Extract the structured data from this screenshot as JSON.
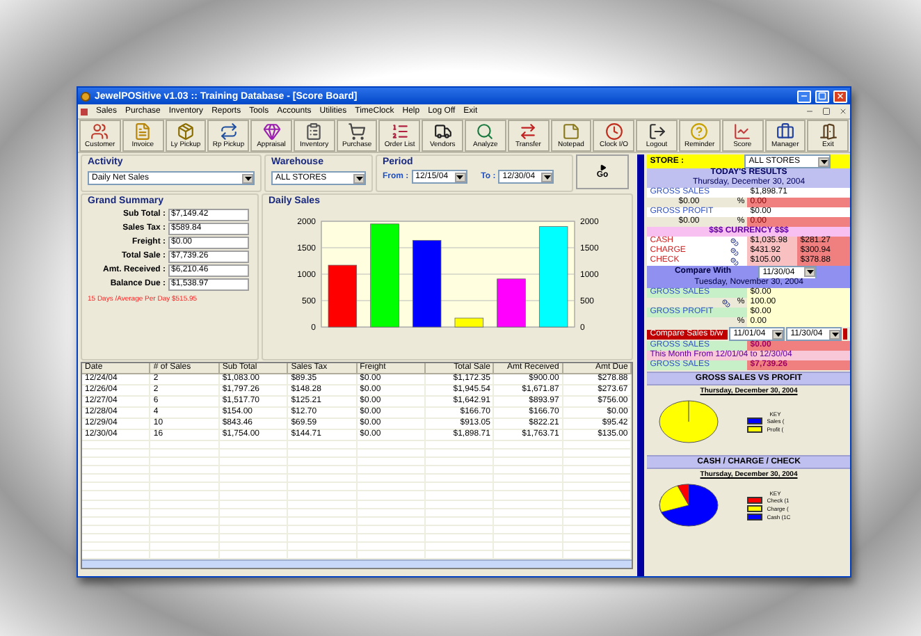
{
  "window": {
    "title": "JewelPOSitive v1.03 :: Training Database - [Score Board]"
  },
  "menu": [
    "Sales",
    "Purchase",
    "Inventory",
    "Reports",
    "Tools",
    "Accounts",
    "Utilities",
    "TimeClock",
    "Help",
    "Log Off",
    "Exit"
  ],
  "toolbar": [
    "Customer",
    "Invoice",
    "Ly Pickup",
    "Rp Pickup",
    "Appraisal",
    "Inventory",
    "Purchase",
    "Order List",
    "Vendors",
    "Analyze",
    "Transfer",
    "Notepad",
    "Clock I/O",
    "Logout",
    "Reminder",
    "Score",
    "Manager",
    "Exit"
  ],
  "filters": {
    "activity": {
      "label": "Activity",
      "value": "Daily Net Sales"
    },
    "warehouse": {
      "label": "Warehouse",
      "value": "ALL STORES"
    },
    "period": {
      "label": "Period",
      "from_label": "From :",
      "from": "12/15/04",
      "to_label": "To :",
      "to": "12/30/04"
    },
    "go_button": "Go"
  },
  "grand_summary": {
    "title": "Grand Summary",
    "fields": [
      {
        "label": "Sub Total :",
        "value": "$7,149.42"
      },
      {
        "label": "Sales Tax :",
        "value": "$589.84"
      },
      {
        "label": "Freight :",
        "value": "$0.00"
      },
      {
        "label": "Total Sale :",
        "value": "$7,739.26"
      },
      {
        "label": "Amt. Received :",
        "value": "$6,210.46"
      },
      {
        "label": "Balance Due :",
        "value": "$1,538.97"
      }
    ],
    "note": "15 Days /Average Per Day $515.95"
  },
  "daily_sales": {
    "title": "Daily Sales",
    "chart_data": {
      "type": "bar",
      "values": [
        1170,
        1950,
        1640,
        170,
        910,
        1900
      ],
      "grid": true,
      "y2lim": [
        0,
        2000
      ],
      "y2ticks": [
        0,
        500,
        1000,
        1500,
        2000
      ],
      "colors": [
        "#ff0000",
        "#00ff00",
        "#0000ff",
        "#ffff00",
        "#ff00ff",
        "#00ffff"
      ],
      "ylim": [
        0,
        2000
      ],
      "yticks": [
        0,
        500,
        1000,
        1500,
        2000
      ]
    }
  },
  "table": {
    "columns": [
      "Date",
      "# of Sales",
      "Sub Total",
      "Sales Tax",
      "Freight",
      "Total Sale",
      "Amt Received",
      "Amt Due"
    ],
    "rows": [
      [
        "12/24/04",
        "2",
        "$1,083.00",
        "$89.35",
        "$0.00",
        "$1,172.35",
        "$900.00",
        "$278.88"
      ],
      [
        "12/26/04",
        "2",
        "$1,797.26",
        "$148.28",
        "$0.00",
        "$1,945.54",
        "$1,671.87",
        "$273.67"
      ],
      [
        "12/27/04",
        "6",
        "$1,517.70",
        "$125.21",
        "$0.00",
        "$1,642.91",
        "$893.97",
        "$756.00"
      ],
      [
        "12/28/04",
        "4",
        "$154.00",
        "$12.70",
        "$0.00",
        "$166.70",
        "$166.70",
        "$0.00"
      ],
      [
        "12/29/04",
        "10",
        "$843.46",
        "$69.59",
        "$0.00",
        "$913.05",
        "$822.21",
        "$95.42"
      ],
      [
        "12/30/04",
        "16",
        "$1,754.00",
        "$144.71",
        "$0.00",
        "$1,898.71",
        "$1,763.71",
        "$135.00"
      ]
    ]
  },
  "score_board": {
    "store": {
      "label": "STORE :",
      "value": "ALL STORES"
    },
    "today": {
      "title": "TODAY'S RESULTS",
      "date": "Thursday, December 30, 2004",
      "gross_sales": {
        "label": "GROSS SALES",
        "value": "$1,898.71",
        "amount": "$0.00",
        "pct_sign": "%",
        "pct": "0.00"
      },
      "gross_profit": {
        "label": "GROSS PROFIT",
        "value": "$0.00",
        "amount": "$0.00",
        "pct_sign": "%",
        "pct": "0.00"
      }
    },
    "currency": {
      "title": "$$$  CURRENCY  $$$",
      "rows": [
        {
          "label": "CASH",
          "value": "$1,035.98",
          "other": "$281.27"
        },
        {
          "label": "CHARGE",
          "value": "$431.92",
          "other": "$300.94"
        },
        {
          "label": "CHECK",
          "value": "$105.00",
          "other": "$378.88"
        }
      ]
    },
    "compare": {
      "label": "Compare With",
      "date_value": "11/30/04",
      "date": "Tuesday, November 30, 2004",
      "gross_sales": {
        "label": "GROSS SALES",
        "value": "$0.00",
        "pct_sign": "%",
        "pct": "100.00"
      },
      "gross_profit": {
        "label": "GROSS PROFIT",
        "value": "$0.00",
        "pct_sign": "%",
        "pct": "0.00"
      }
    },
    "range": {
      "label": "Compare Sales b/w",
      "from": "11/01/04",
      "to": "11/30/04",
      "gross_sales": {
        "label": "GROSS SALES",
        "value": "$0.00"
      }
    },
    "month": {
      "text": "This Month From 12/01/04 to 12/30/04",
      "gross_sales": {
        "label": "GROSS SALES",
        "value": "$7,739.26"
      }
    },
    "pies": [
      {
        "kind": "profit",
        "title": "GROSS SALES VS PROFIT",
        "date": "Thursday, December 30, 2004",
        "key_title": "KEY",
        "legend": [
          {
            "label": "Sales (",
            "color": "#0000ff"
          },
          {
            "label": "Profit (",
            "color": "#ffff00"
          }
        ]
      },
      {
        "kind": "payment",
        "title": "CASH / CHARGE / CHECK",
        "date": "Thursday, December 30, 2004",
        "key_title": "KEY",
        "legend": [
          {
            "label": "Check (1",
            "color": "#ff0000"
          },
          {
            "label": "Charge (",
            "color": "#ffff00"
          },
          {
            "label": "Cash (1C",
            "color": "#0000ff"
          }
        ]
      }
    ]
  }
}
